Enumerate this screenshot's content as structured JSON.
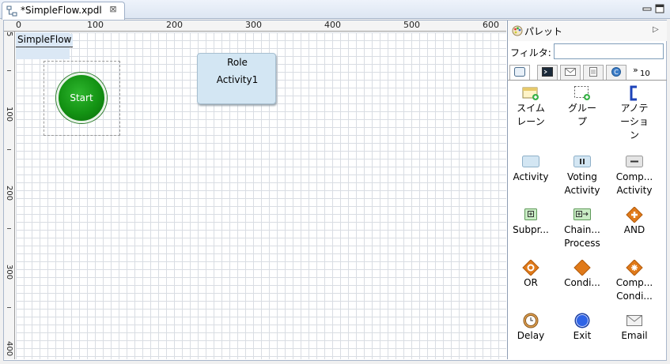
{
  "tab": {
    "title": "*SimpleFlow.xpdl",
    "close": "⊠"
  },
  "ruler": {
    "h_labels": [
      "0",
      "100",
      "200",
      "300",
      "400",
      "500",
      "600"
    ],
    "v_labels": [
      "5",
      "100",
      "200",
      "300",
      "400"
    ]
  },
  "canvas": {
    "pool_label": "SimpleFlow",
    "start_label": "Start",
    "activity": {
      "role": "Role",
      "name": "Activity1"
    }
  },
  "palette": {
    "title": "パレット",
    "filter_label": "フィルタ:",
    "filter_value": "",
    "more_count": "10",
    "tools": [
      {
        "lines": [
          "スイム",
          "レーン"
        ],
        "icon": "swimlane-icon"
      },
      {
        "lines": [
          "グルー",
          "プ"
        ],
        "icon": "group-icon"
      },
      {
        "lines": [
          "アノテ",
          "ーショ",
          "ン"
        ],
        "icon": "annotation-icon"
      },
      {
        "lines": [
          "Activity"
        ],
        "icon": "activity-icon"
      },
      {
        "lines": [
          "Voting",
          "Activity"
        ],
        "icon": "voting-activity-icon"
      },
      {
        "lines": [
          "Comp...",
          "Activity"
        ],
        "icon": "compensation-activity-icon"
      },
      {
        "lines": [
          "Subpr..."
        ],
        "icon": "subprocess-icon"
      },
      {
        "lines": [
          "Chain...",
          "Process"
        ],
        "icon": "chained-process-icon"
      },
      {
        "lines": [
          "AND"
        ],
        "icon": "and-gateway-icon"
      },
      {
        "lines": [
          "OR"
        ],
        "icon": "or-gateway-icon"
      },
      {
        "lines": [
          "Condi..."
        ],
        "icon": "conditional-gateway-icon"
      },
      {
        "lines": [
          "Comp...",
          "Condi..."
        ],
        "icon": "complex-conditional-icon"
      },
      {
        "lines": [
          "Delay"
        ],
        "icon": "delay-icon"
      },
      {
        "lines": [
          "Exit"
        ],
        "icon": "exit-icon"
      },
      {
        "lines": [
          "Email"
        ],
        "icon": "email-icon"
      }
    ]
  }
}
